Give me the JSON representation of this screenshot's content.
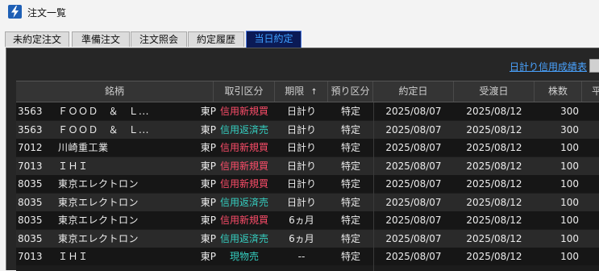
{
  "window": {
    "title": "注文一覧",
    "accent": "#1e5fb5"
  },
  "tabs": [
    {
      "label": "未約定注文",
      "active": false
    },
    {
      "label": "準備注文",
      "active": false
    },
    {
      "label": "注文照会",
      "active": false
    },
    {
      "label": "約定履歴",
      "active": false
    },
    {
      "label": "当日約定",
      "active": true
    }
  ],
  "link_label": "日計り信用成績表",
  "columns": {
    "name": "銘柄",
    "kind": "取引区分",
    "term": "期限",
    "term_sort": "↑",
    "deposit": "預り区分",
    "exec_date": "約定日",
    "settle_date": "受渡日",
    "qty": "株数",
    "partial": "平"
  },
  "colors": {
    "new": "#ff4d6a",
    "close": "#35d0c2",
    "link": "#4aa3ff",
    "active_tab": "#0b1a55"
  },
  "rows": [
    {
      "code": "3563",
      "name": "ＦＯＯＤ　＆　Ｌ...",
      "market": "東P",
      "kind": "信用新規買",
      "kind_type": "new",
      "term": "日計り",
      "deposit": "特定",
      "exec_date": "2025/08/07",
      "settle_date": "2025/08/12",
      "qty": "300"
    },
    {
      "code": "3563",
      "name": "ＦＯＯＤ　＆　Ｌ...",
      "market": "東P",
      "kind": "信用返済売",
      "kind_type": "close",
      "term": "日計り",
      "deposit": "特定",
      "exec_date": "2025/08/07",
      "settle_date": "2025/08/12",
      "qty": "300"
    },
    {
      "code": "7012",
      "name": "川崎重工業",
      "market": "東P",
      "kind": "信用新規買",
      "kind_type": "new",
      "term": "日計り",
      "deposit": "特定",
      "exec_date": "2025/08/07",
      "settle_date": "2025/08/12",
      "qty": "100"
    },
    {
      "code": "7013",
      "name": "ＩＨＩ",
      "market": "東P",
      "kind": "信用新規買",
      "kind_type": "new",
      "term": "日計り",
      "deposit": "特定",
      "exec_date": "2025/08/07",
      "settle_date": "2025/08/12",
      "qty": "100"
    },
    {
      "code": "8035",
      "name": "東京エレクトロン",
      "market": "東P",
      "kind": "信用新規買",
      "kind_type": "new",
      "term": "日計り",
      "deposit": "特定",
      "exec_date": "2025/08/07",
      "settle_date": "2025/08/12",
      "qty": "100"
    },
    {
      "code": "8035",
      "name": "東京エレクトロン",
      "market": "東P",
      "kind": "信用返済売",
      "kind_type": "close",
      "term": "日計り",
      "deposit": "特定",
      "exec_date": "2025/08/07",
      "settle_date": "2025/08/12",
      "qty": "100"
    },
    {
      "code": "8035",
      "name": "東京エレクトロン",
      "market": "東P",
      "kind": "信用新規買",
      "kind_type": "new",
      "term": "6ヵ月",
      "deposit": "特定",
      "exec_date": "2025/08/07",
      "settle_date": "2025/08/12",
      "qty": "100"
    },
    {
      "code": "8035",
      "name": "東京エレクトロン",
      "market": "東P",
      "kind": "信用返済売",
      "kind_type": "close",
      "term": "6ヵ月",
      "deposit": "特定",
      "exec_date": "2025/08/07",
      "settle_date": "2025/08/12",
      "qty": "100"
    },
    {
      "code": "7013",
      "name": "ＩＨＩ",
      "market": "東P",
      "kind": "現物売",
      "kind_type": "spot",
      "term": "--",
      "deposit": "特定",
      "exec_date": "2025/08/07",
      "settle_date": "2025/08/12",
      "qty": "100"
    }
  ]
}
